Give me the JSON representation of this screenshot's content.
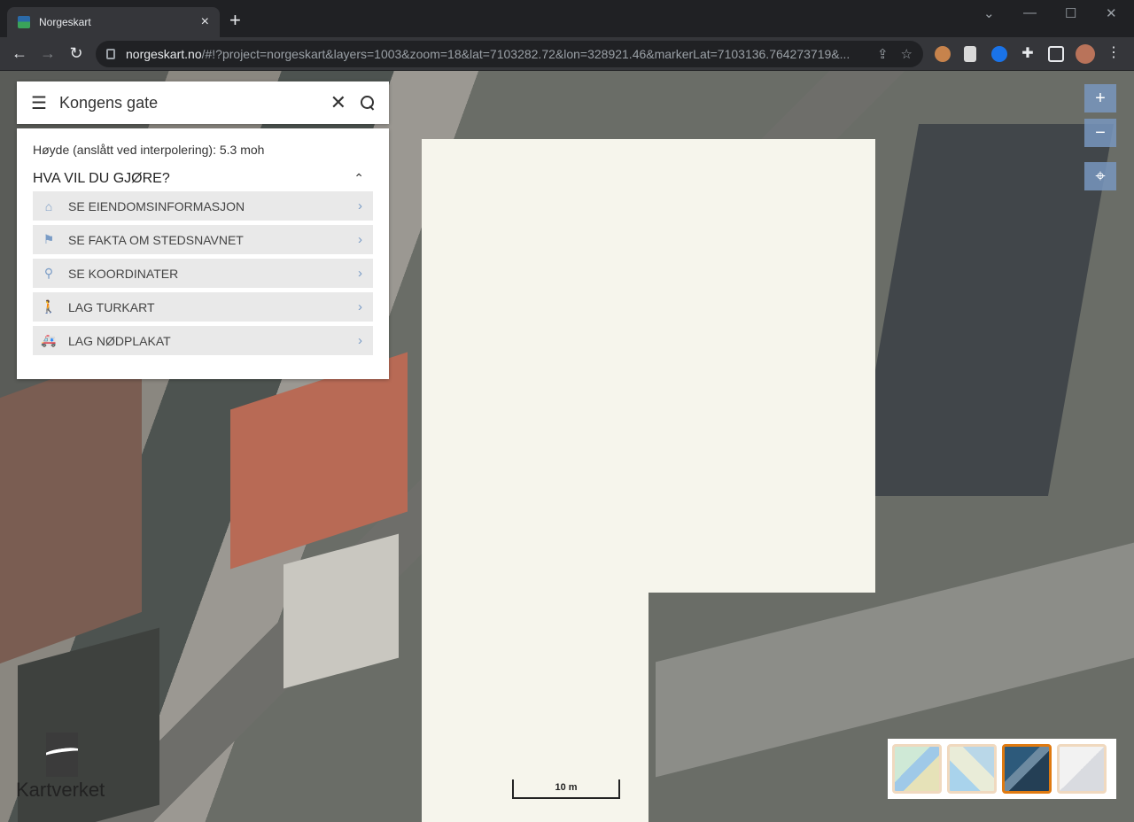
{
  "browser": {
    "tab_title": "Norgeskart",
    "tab_close": "×",
    "new_tab": "+",
    "url_host": "norgeskart.no",
    "url_rest": "/#!?project=norgeskart&layers=1003&zoom=18&lat=7103282.72&lon=328921.46&markerLat=7103136.764273719&...",
    "window_controls": [
      "⌄",
      "—",
      "☐",
      "✕"
    ]
  },
  "search": {
    "menu_icon": "☰",
    "query": "Kongens gate",
    "clear_icon": "✕"
  },
  "panel": {
    "height_text": "Høyde (anslått ved interpolering): 5.3 moh",
    "header": "HVA VIL DU GJØRE?",
    "header_chevron": "⌃",
    "options": [
      {
        "label": "SE EIENDOMSINFORMASJON",
        "icon": "⌂"
      },
      {
        "label": "SE FAKTA OM STEDSNAVNET",
        "icon": "⚑"
      },
      {
        "label": "SE KOORDINATER",
        "icon": "⚲"
      },
      {
        "label": "LAG TURKART",
        "icon": "🚶"
      },
      {
        "label": "LAG NØDPLAKAT",
        "icon": "🚑"
      }
    ],
    "option_arrow": "›"
  },
  "map_controls": {
    "zoom_in": "+",
    "zoom_out": "−",
    "locate": "⌖"
  },
  "logo": {
    "text": "Kartverket"
  },
  "scale": {
    "label": "10 m"
  },
  "basemaps": {
    "selected_index": 2
  }
}
